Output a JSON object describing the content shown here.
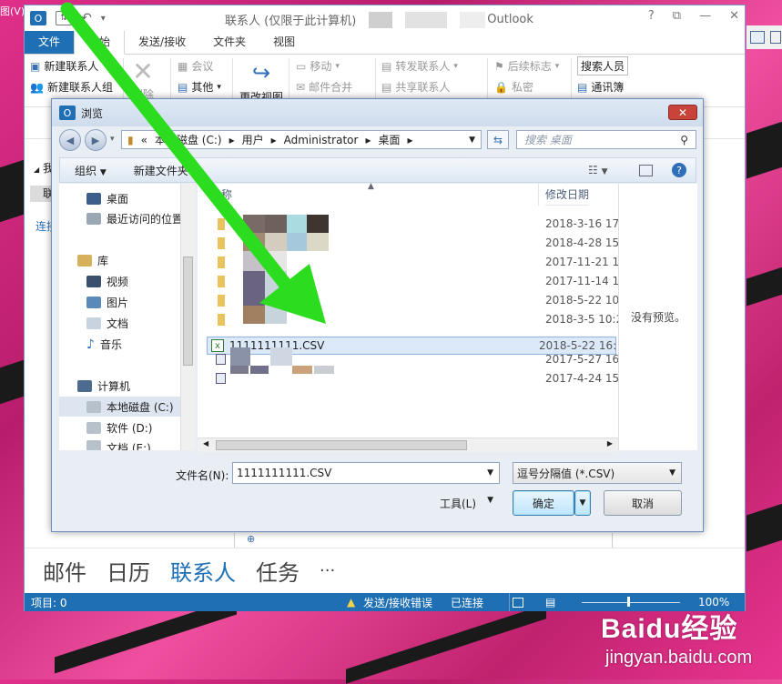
{
  "background": {
    "menu_fragment": "图(V)"
  },
  "outlook": {
    "window_title": "联系人 (仅限于此计算机)",
    "app_name": "Outlook",
    "window_controls": [
      "?",
      "⧉",
      "—",
      "✕"
    ],
    "tabs": [
      "文件",
      "开始",
      "发送/接收",
      "文件夹",
      "视图"
    ],
    "ribbon": {
      "new_contact": "新建联系人",
      "new_group": "新建联系人组",
      "delete": "删除",
      "meeting": "会议",
      "other": "其他",
      "change_view": "更改视图",
      "move": "移动",
      "mail_merge": "邮件合并",
      "forward_contact": "转发联系人",
      "share_contact": "共享联系人",
      "follow_up": "后续标志",
      "private": "私密",
      "search_people": "搜索人员",
      "address_book": "通讯簿"
    },
    "left_fragments": {
      "my": "我",
      "contacts": "联",
      "connect": "连接"
    },
    "nav": [
      "邮件",
      "日历",
      "联系人",
      "任务",
      "···"
    ],
    "status": {
      "items": "项目: 0",
      "send_receive_error": "发送/接收错误",
      "connected": "已连接",
      "zoom": "100%"
    }
  },
  "dialog": {
    "title": "浏览",
    "address": [
      "本地磁盘 (C:)",
      "用户",
      "Administrator",
      "桌面"
    ],
    "address_prefix": "«",
    "search_placeholder": "搜索 桌面",
    "toolbar": {
      "organize": "组织",
      "new_folder": "新建文件夹"
    },
    "tree": {
      "desktop": "桌面",
      "recent": "最近访问的位置",
      "library": "库",
      "video": "视频",
      "pictures": "图片",
      "documents": "文档",
      "music": "音乐",
      "computer": "计算机",
      "drive_c": "本地磁盘 (C:)",
      "drive_d": "软件 (D:)",
      "drive_e": "文档 (E:)"
    },
    "columns": {
      "name": "名称",
      "modified": "修改日期"
    },
    "files": [
      {
        "name": "",
        "date": "2018-3-16 17:"
      },
      {
        "name": "",
        "date": "2018-4-28 15:"
      },
      {
        "name": "",
        "date": "2017-11-21 1("
      },
      {
        "name": "",
        "date": "2017-11-14 1("
      },
      {
        "name": "",
        "date": "2018-5-22 10:"
      },
      {
        "name": "",
        "date": "2018-3-5 10:2"
      },
      {
        "name": "1111111111.CSV",
        "date": "2018-5-22 16:"
      },
      {
        "name": "",
        "date": "2017-5-27 16:"
      },
      {
        "name": "",
        "date": "2017-4-24 15:"
      }
    ],
    "preview_text": "没有预览。",
    "filename_label": "文件名(N):",
    "filename_value": "1111111111.CSV",
    "filetype_value": "逗号分隔值 (*.CSV)",
    "tools_label": "工具(L)",
    "ok_label": "确定",
    "cancel_label": "取消"
  },
  "watermark": {
    "brand": "Baidu经验",
    "url": "jingyan.baidu.com"
  },
  "colors": {
    "accent": "#1f6fb5",
    "arrow": "#2bdc1f",
    "background": "#e0308a"
  }
}
